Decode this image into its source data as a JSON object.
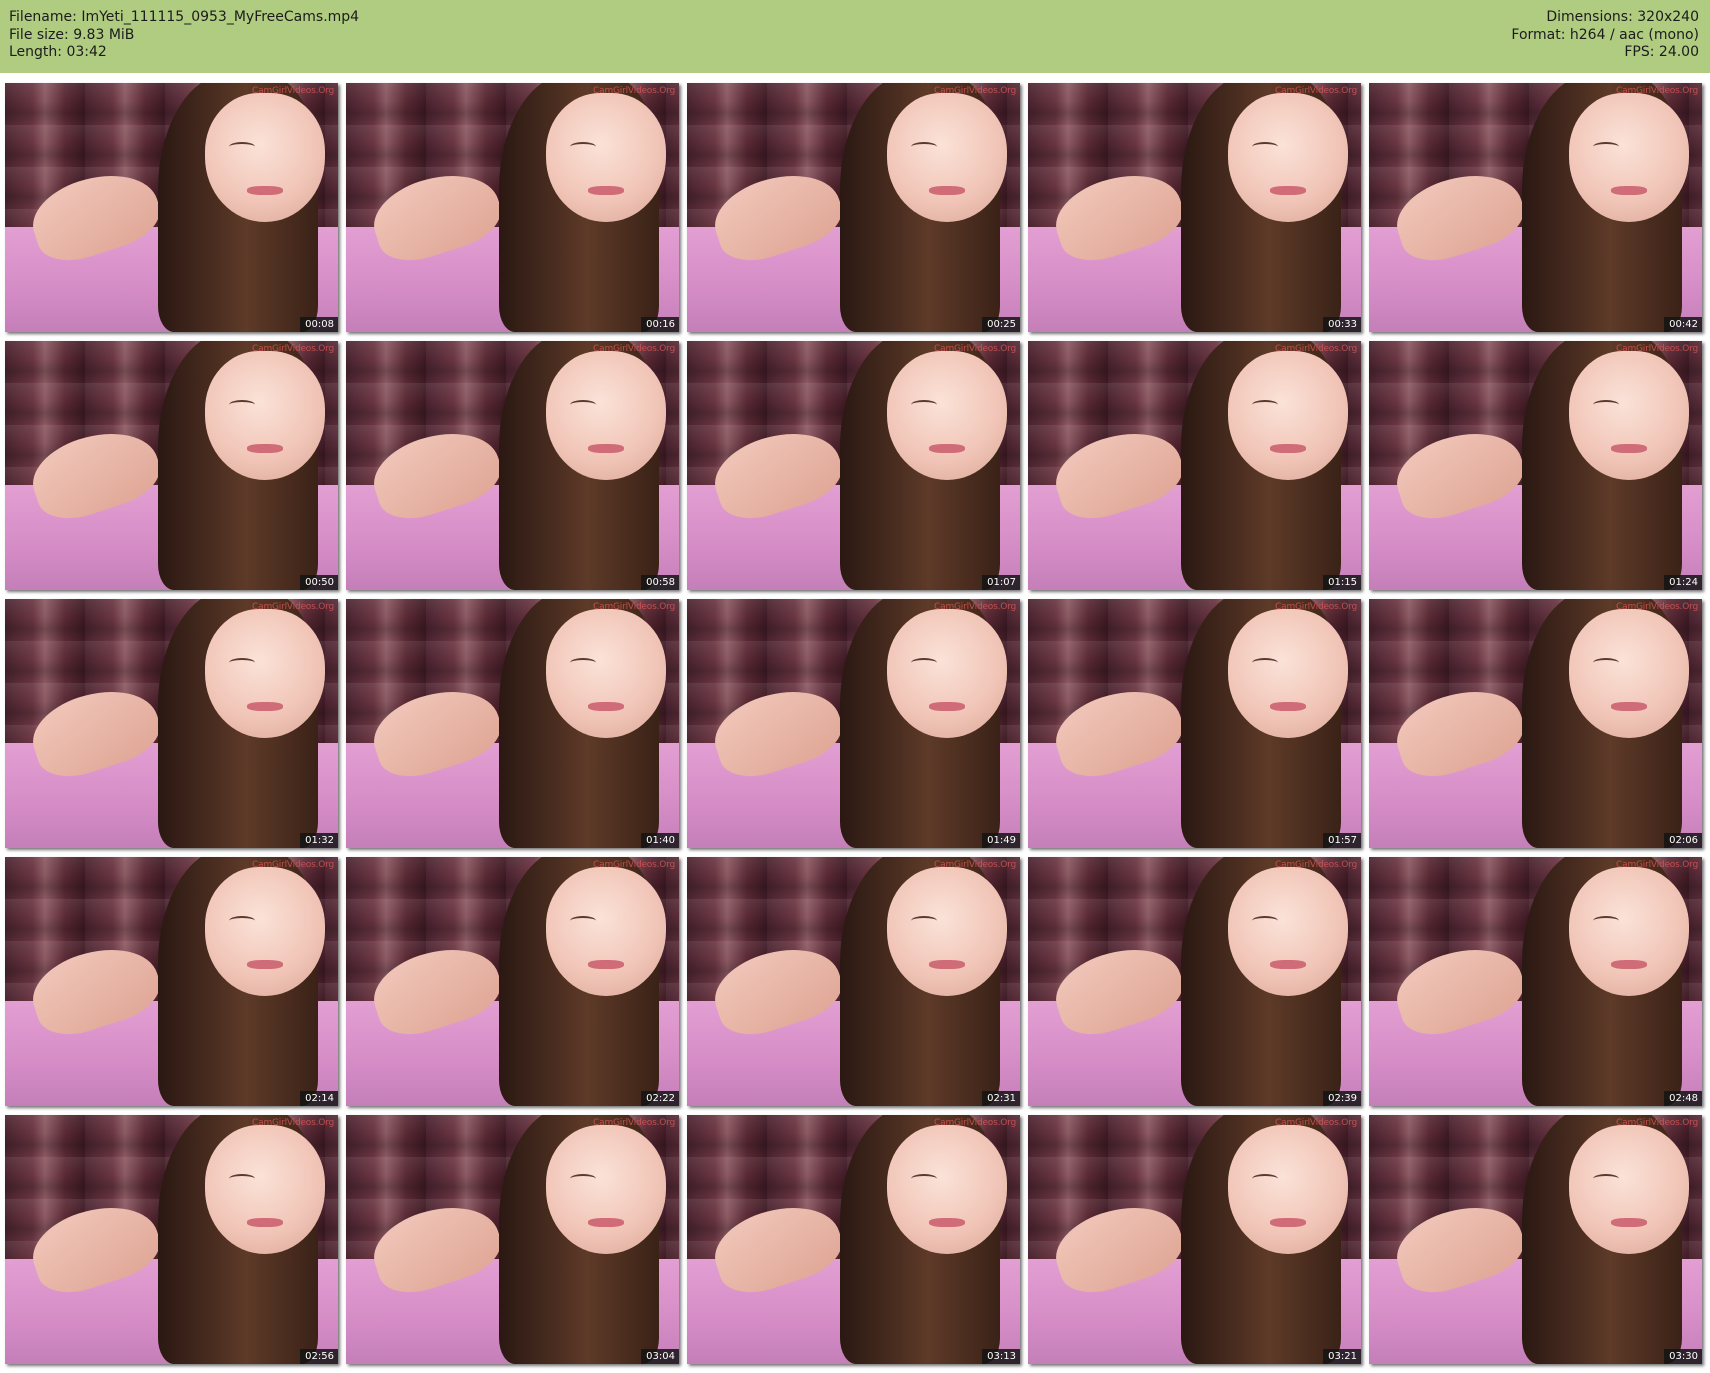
{
  "header": {
    "left": [
      {
        "label": "Filename:",
        "value": "ImYeti_111115_0953_MyFreeCams.mp4"
      },
      {
        "label": "File size:",
        "value": "9.83 MiB"
      },
      {
        "label": "Length:",
        "value": "03:42"
      }
    ],
    "right": [
      {
        "label": "Dimensions:",
        "value": "320x240"
      },
      {
        "label": "Format:",
        "value": "h264 / aac (mono)"
      },
      {
        "label": "FPS:",
        "value": "24.00"
      }
    ],
    "background_color": "#b0cc81"
  },
  "thumbnails": {
    "watermark": "CamGirlVideos.Org",
    "timestamps": [
      "00:08",
      "00:16",
      "00:25",
      "00:33",
      "00:42",
      "00:50",
      "00:58",
      "01:07",
      "01:15",
      "01:24",
      "01:32",
      "01:40",
      "01:49",
      "01:57",
      "02:06",
      "02:14",
      "02:22",
      "02:31",
      "02:39",
      "02:48",
      "02:56",
      "03:04",
      "03:13",
      "03:21",
      "03:30"
    ]
  }
}
